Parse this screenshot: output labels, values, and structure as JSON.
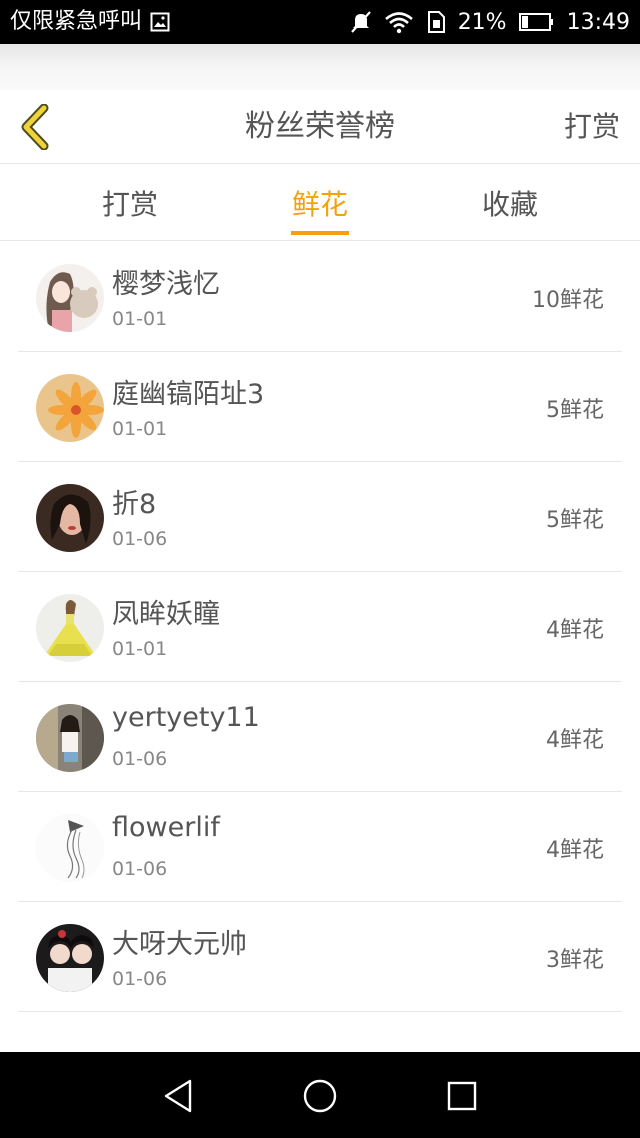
{
  "status_bar": {
    "carrier": "仅限紧急呼叫",
    "battery_percent": "21%",
    "time": "13:49"
  },
  "header": {
    "title": "粉丝荣誉榜",
    "right_action": "打赏",
    "back_icon": "chevron-left-icon"
  },
  "tabs": [
    {
      "label": "打赏",
      "active": false
    },
    {
      "label": "鲜花",
      "active": true
    },
    {
      "label": "收藏",
      "active": false
    }
  ],
  "colors": {
    "accent": "#f3a20c",
    "text_primary": "#555555",
    "text_secondary": "#888888",
    "divider": "#e6e6e6"
  },
  "fans": [
    {
      "name": "樱梦浅忆",
      "date": "01-01",
      "count": "10鲜花"
    },
    {
      "name": "庭幽镐陌址3",
      "date": "01-01",
      "count": "5鲜花"
    },
    {
      "name": "折8",
      "date": "01-06",
      "count": "5鲜花"
    },
    {
      "name": "凤眸妖瞳",
      "date": "01-01",
      "count": "4鲜花"
    },
    {
      "name": "yertyety11",
      "date": "01-06",
      "count": "4鲜花"
    },
    {
      "name": "flowerlif",
      "date": "01-06",
      "count": "4鲜花"
    },
    {
      "name": "大呀大元帅",
      "date": "01-06",
      "count": "3鲜花"
    }
  ],
  "nav_bar": {
    "icons": [
      "back-triangle-icon",
      "home-circle-icon",
      "recents-square-icon"
    ]
  }
}
